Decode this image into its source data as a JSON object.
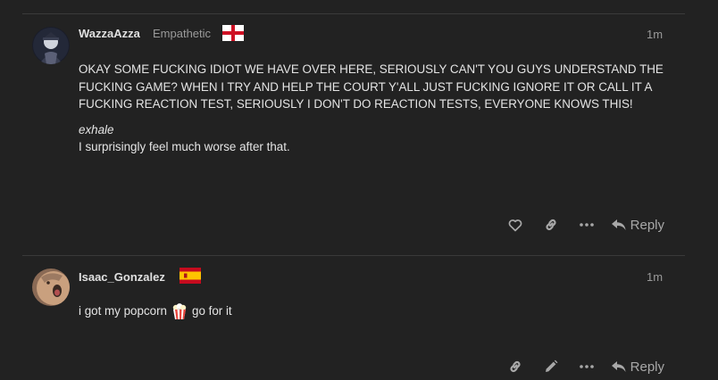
{
  "posts": [
    {
      "username": "WazzaAzza",
      "user_title": "Empathetic",
      "flag_icon": "england-flag-icon",
      "date": "1m",
      "paragraphs": [
        "OKAY SOME FUCKING IDIOT WE HAVE OVER HERE, SERIOUSLY CAN'T YOU GUYS UNDERSTAND THE FUCKING GAME? WHEN I TRY AND HELP THE COURT Y'ALL JUST FUCKING IGNORE IT OR CALL IT A FUCKING REACTION TEST, SERIOUSLY I DON'T DO REACTION TESTS, EVERYONE KNOWS THIS!"
      ],
      "italic_line": "exhale",
      "last_line": "I surprisingly feel much worse after that.",
      "actions": [
        "heart-icon",
        "link-icon",
        "more-icon"
      ],
      "reply_label": "Reply"
    },
    {
      "username": "Isaac_Gonzalez",
      "flag_icon": "spain-flag-icon",
      "date": "1m",
      "text_before_emoji": "i got my popcorn",
      "emoji": "popcorn-emoji",
      "text_after_emoji": "go for it",
      "actions": [
        "link-icon",
        "pencil-icon",
        "more-icon"
      ],
      "reply_label": "Reply"
    }
  ],
  "colors": {
    "background": "#222222",
    "divider": "#3a3a3a",
    "text": "#e4e4e4",
    "muted": "#9a9a9a"
  }
}
